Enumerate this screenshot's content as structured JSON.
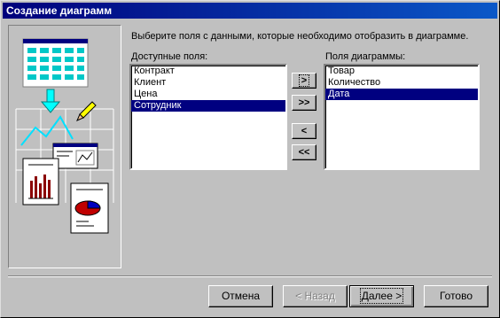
{
  "window": {
    "title": "Создание диаграмм"
  },
  "instruction": "Выберите поля с данными, которые необходимо отобразить в диаграмме.",
  "available": {
    "label": "Доступные поля:",
    "items": [
      "Контракт",
      "Клиент",
      "Цена",
      "Сотрудник"
    ],
    "selected_index": 3
  },
  "chart_fields": {
    "label": "Поля диаграммы:",
    "items": [
      "Товар",
      "Количество",
      "Дата"
    ],
    "selected_index": 2
  },
  "move_buttons": {
    "add_one": ">",
    "add_all": ">>",
    "remove_one": "<",
    "remove_all": "<<"
  },
  "buttons": {
    "cancel": "Отмена",
    "back": "< Назад",
    "next": "Далее >",
    "finish": "Готово"
  },
  "icons": {
    "illustration": "chart-wizard-illustration",
    "arrow": "down-arrow-icon",
    "pencil": "pencil-icon"
  }
}
